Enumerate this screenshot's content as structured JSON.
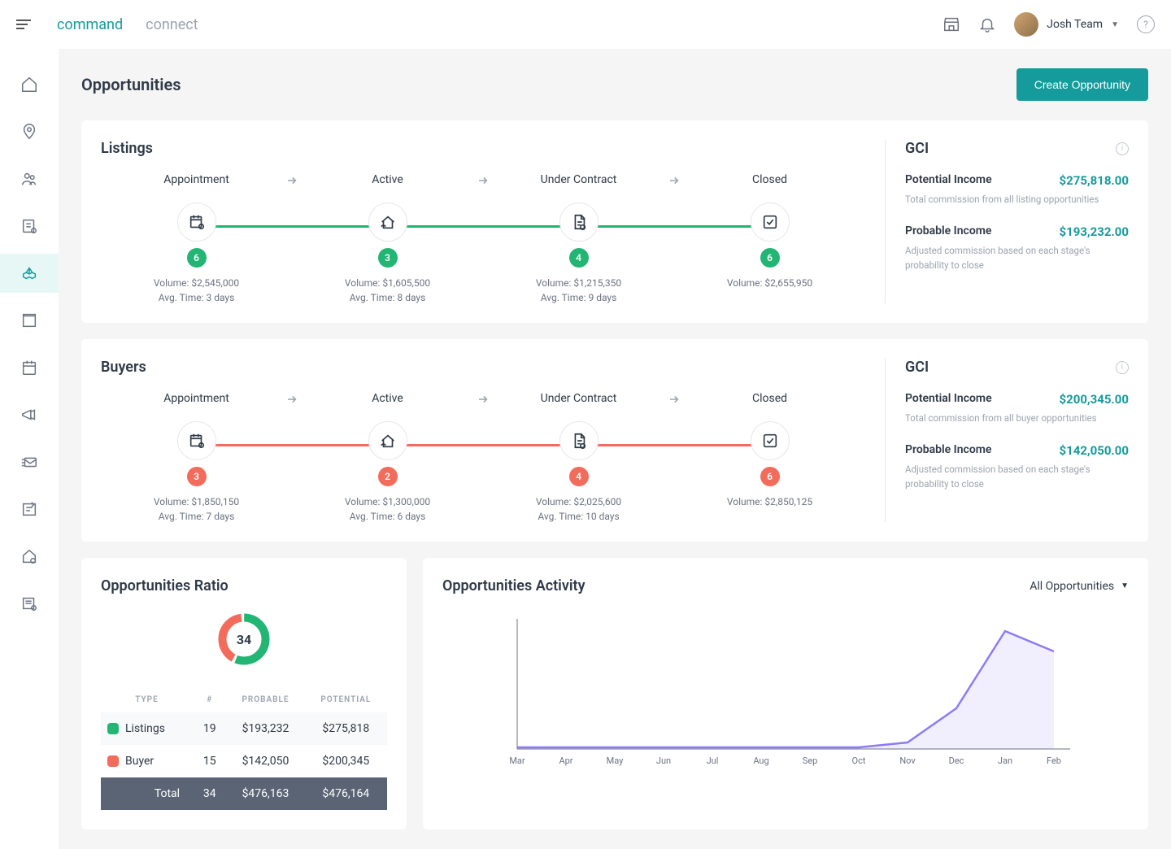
{
  "header": {
    "tabs": [
      "command",
      "connect"
    ],
    "user_name": "Josh Team"
  },
  "page": {
    "title": "Opportunities",
    "create_btn": "Create Opportunity"
  },
  "listings": {
    "title": "Listings",
    "stages": [
      {
        "label": "Appointment",
        "count": 6,
        "volume": "Volume: $2,545,000",
        "time": "Avg. Time: 3 days"
      },
      {
        "label": "Active",
        "count": 3,
        "volume": "Volume: $1,605,500",
        "time": "Avg. Time: 8 days"
      },
      {
        "label": "Under Contract",
        "count": 4,
        "volume": "Volume: $1,215,350",
        "time": "Avg. Time: 9 days"
      },
      {
        "label": "Closed",
        "count": 6,
        "volume": "Volume: $2,655,950",
        "time": ""
      }
    ],
    "gci": {
      "title": "GCI",
      "potential_label": "Potential Income",
      "potential_value": "$275,818.00",
      "potential_desc": "Total commission from all listing opportunities",
      "probable_label": "Probable Income",
      "probable_value": "$193,232.00",
      "probable_desc": "Adjusted commission based on each stage's probability to close"
    }
  },
  "buyers": {
    "title": "Buyers",
    "stages": [
      {
        "label": "Appointment",
        "count": 3,
        "volume": "Volume: $1,850,150",
        "time": "Avg. Time: 7 days"
      },
      {
        "label": "Active",
        "count": 2,
        "volume": "Volume: $1,300,000",
        "time": "Avg. Time: 6 days"
      },
      {
        "label": "Under Contract",
        "count": 4,
        "volume": "Volume: $2,025,600",
        "time": "Avg. Time: 10 days"
      },
      {
        "label": "Closed",
        "count": 6,
        "volume": "Volume: $2,850,125",
        "time": ""
      }
    ],
    "gci": {
      "title": "GCI",
      "potential_label": "Potential Income",
      "potential_value": "$200,345.00",
      "potential_desc": "Total commission from all buyer opportunities",
      "probable_label": "Probable Income",
      "probable_value": "$142,050.00",
      "probable_desc": "Adjusted commission based on each stage's probability to close"
    }
  },
  "ratio": {
    "title": "Opportunities Ratio",
    "center": "34",
    "headers": {
      "type": "TYPE",
      "count": "#",
      "probable": "PROBABLE",
      "potential": "POTENTIAL"
    },
    "rows": [
      {
        "type": "Listings",
        "count": "19",
        "probable": "$193,232",
        "potential": "$275,818"
      },
      {
        "type": "Buyer",
        "count": "15",
        "probable": "$142,050",
        "potential": "$200,345"
      }
    ],
    "total": {
      "type": "Total",
      "count": "34",
      "probable": "$476,163",
      "potential": "$476,164"
    }
  },
  "activity": {
    "title": "Opportunities Activity",
    "filter": "All Opportunities",
    "months": [
      "Mar",
      "Apr",
      "May",
      "Jun",
      "Jul",
      "Aug",
      "Sep",
      "Oct",
      "Nov",
      "Dec",
      "Jan",
      "Feb"
    ]
  },
  "chart_data": {
    "type": "line",
    "title": "Opportunities Activity",
    "x": [
      "Mar",
      "Apr",
      "May",
      "Jun",
      "Jul",
      "Aug",
      "Sep",
      "Oct",
      "Nov",
      "Dec",
      "Jan",
      "Feb"
    ],
    "series": [
      {
        "name": "All Opportunities",
        "values": [
          0,
          0,
          0,
          0,
          0,
          0,
          0,
          0,
          2,
          20,
          95,
          80
        ]
      }
    ],
    "xlabel": "",
    "ylabel": "",
    "ylim": [
      0,
      100
    ]
  }
}
